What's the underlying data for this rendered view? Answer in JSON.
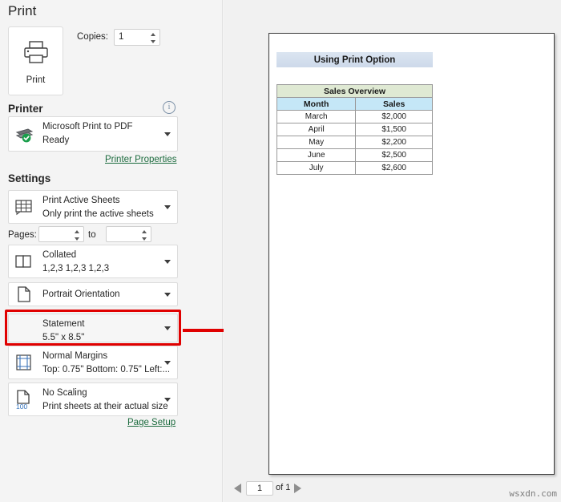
{
  "header": {
    "title": "Print"
  },
  "print_button": {
    "label": "Print",
    "icon": "printer-icon"
  },
  "copies": {
    "label": "Copies:",
    "value": "1"
  },
  "printer": {
    "heading": "Printer",
    "info_icon": "info-icon",
    "name": "Microsoft Print to PDF",
    "status": "Ready",
    "icon": "printer-ready-icon",
    "properties_link": "Printer Properties"
  },
  "settings": {
    "heading": "Settings",
    "rows": [
      {
        "name": "print-area",
        "title": "Print Active Sheets",
        "subtitle": "Only print the active sheets",
        "icon": "sheet-grid-icon"
      },
      {
        "name": "collation",
        "title": "Collated",
        "subtitle": "1,2,3   1,2,3   1,2,3",
        "icon": "collate-icon"
      },
      {
        "name": "orientation",
        "title": "Portrait Orientation",
        "subtitle": "",
        "icon": "portrait-page-icon"
      },
      {
        "name": "paper-size",
        "title": "Statement",
        "subtitle": "5.5\" x 8.5\"",
        "icon": "",
        "highlighted": true
      },
      {
        "name": "margins",
        "title": "Normal Margins",
        "subtitle": "Top: 0.75\" Bottom: 0.75\" Left:...",
        "icon": "margins-icon"
      },
      {
        "name": "scaling",
        "title": "No Scaling",
        "subtitle": "Print sheets at their actual size",
        "icon": "scaling-100-icon"
      }
    ],
    "pages": {
      "label": "Pages:",
      "from": "",
      "to_label": "to",
      "to": ""
    },
    "page_setup_link": "Page Setup"
  },
  "annotation": {
    "highlight_color": "#e00000",
    "arrow_color": "#e00000",
    "target": "paper-size"
  },
  "preview": {
    "sheet_title": "Using Print Option",
    "table": {
      "caption": "Sales Overview",
      "columns": [
        "Month",
        "Sales"
      ],
      "rows": [
        [
          "March",
          "$2,000"
        ],
        [
          "April",
          "$1,500"
        ],
        [
          "May",
          "$2,200"
        ],
        [
          "June",
          "$2,500"
        ],
        [
          "July",
          "$2,600"
        ]
      ]
    },
    "colors": {
      "title_banner": "#cdd9ea",
      "table_caption": "#dfe9d3",
      "table_header": "#c5e7f7"
    }
  },
  "pager": {
    "current": "1",
    "of_text": "of 1",
    "prev_icon": "triangle-left-icon",
    "next_icon": "triangle-right-icon"
  },
  "watermark": "wsxdn.com"
}
